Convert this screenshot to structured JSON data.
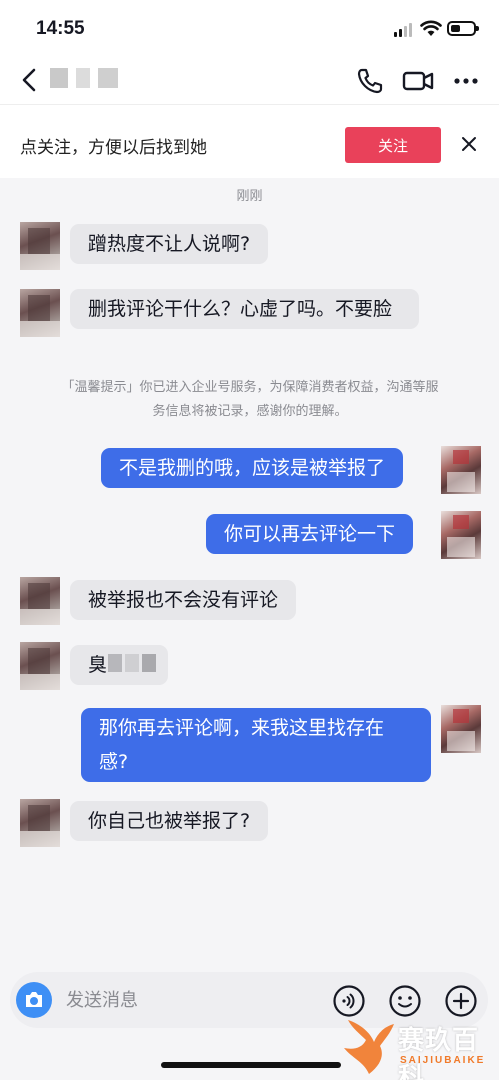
{
  "status_bar": {
    "time": "14:55",
    "battery_level": 0.45
  },
  "nav": {
    "back_icon": "chevron-left-icon",
    "phone_icon": "phone-icon",
    "video_icon": "video-camera-icon",
    "more_icon": "more-dots-icon"
  },
  "follow_bar": {
    "text": "点关注，方便以后找到她",
    "button_label": "关注",
    "close_icon": "close-icon"
  },
  "chat": {
    "timestamp": "刚刚",
    "notice": "「温馨提示」你已进入企业号服务，为保障消费者权益，沟通等服务信息将被记录，感谢你的理解。",
    "messages": [
      {
        "side": "in",
        "text": "蹭热度不让人说啊?"
      },
      {
        "side": "in",
        "text": "删我评论干什么？心虚了吗。不要脸"
      },
      {
        "side": "out",
        "text": "不是我删的哦，应该是被举报了"
      },
      {
        "side": "out",
        "text": "你可以再去评论一下"
      },
      {
        "side": "in",
        "text": "被举报也不会没有评论"
      },
      {
        "side": "in",
        "text": "臭"
      },
      {
        "side": "out",
        "text": "那你再去评论啊，来我这里找存在感?"
      },
      {
        "side": "in",
        "text": "你自己也被举报了?"
      }
    ]
  },
  "input_bar": {
    "placeholder": "发送消息",
    "camera_icon": "camera-icon",
    "voice_icon": "voice-icon",
    "emoji_icon": "emoji-icon",
    "plus_icon": "plus-icon"
  },
  "watermark": {
    "cn": "赛玖百科",
    "en": "SAIJIUBAIKE"
  },
  "colors": {
    "accent_red": "#e9415a",
    "bubble_blue": "#3e6de8",
    "bubble_gray": "#e7e7ea",
    "camera_blue": "#3e8ff5",
    "watermark_orange": "#f07a2a"
  }
}
